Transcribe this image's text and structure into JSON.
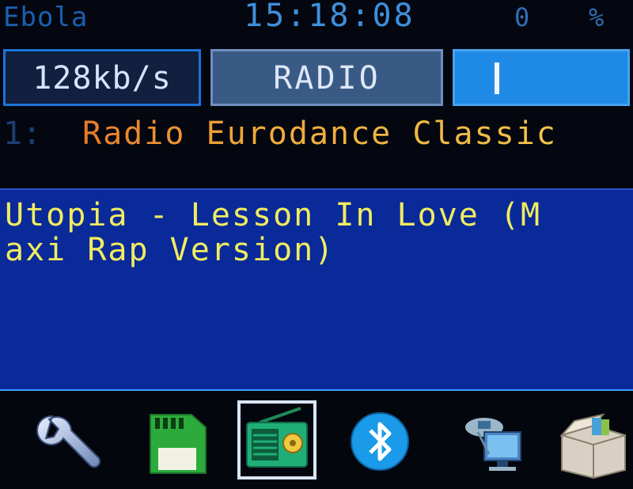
{
  "status": {
    "device_name": "Ebola",
    "time": "15:18:08",
    "volume_value": "0",
    "percent_symbol": "%"
  },
  "info_boxes": {
    "bitrate": "128kb/s",
    "mode": "RADIO",
    "volume_fill": 0
  },
  "station": {
    "index": "1:",
    "name": "Radio Eurodance Classic"
  },
  "now_playing": {
    "line1": "Utopia - Lesson In Love (M",
    "line2": "axi Rap Version)"
  },
  "toolbar": {
    "items": [
      {
        "icon": "wrench-icon"
      },
      {
        "icon": "sd-card-icon"
      },
      {
        "icon": "radio-icon",
        "selected": true
      },
      {
        "icon": "bluetooth-icon"
      },
      {
        "icon": "network-icon"
      },
      {
        "icon": "box-icon"
      }
    ]
  },
  "colors": {
    "title_text": "#f0ec60",
    "panel_bg": "#0a2a9a",
    "accent_blue": "#1e8ae6"
  }
}
